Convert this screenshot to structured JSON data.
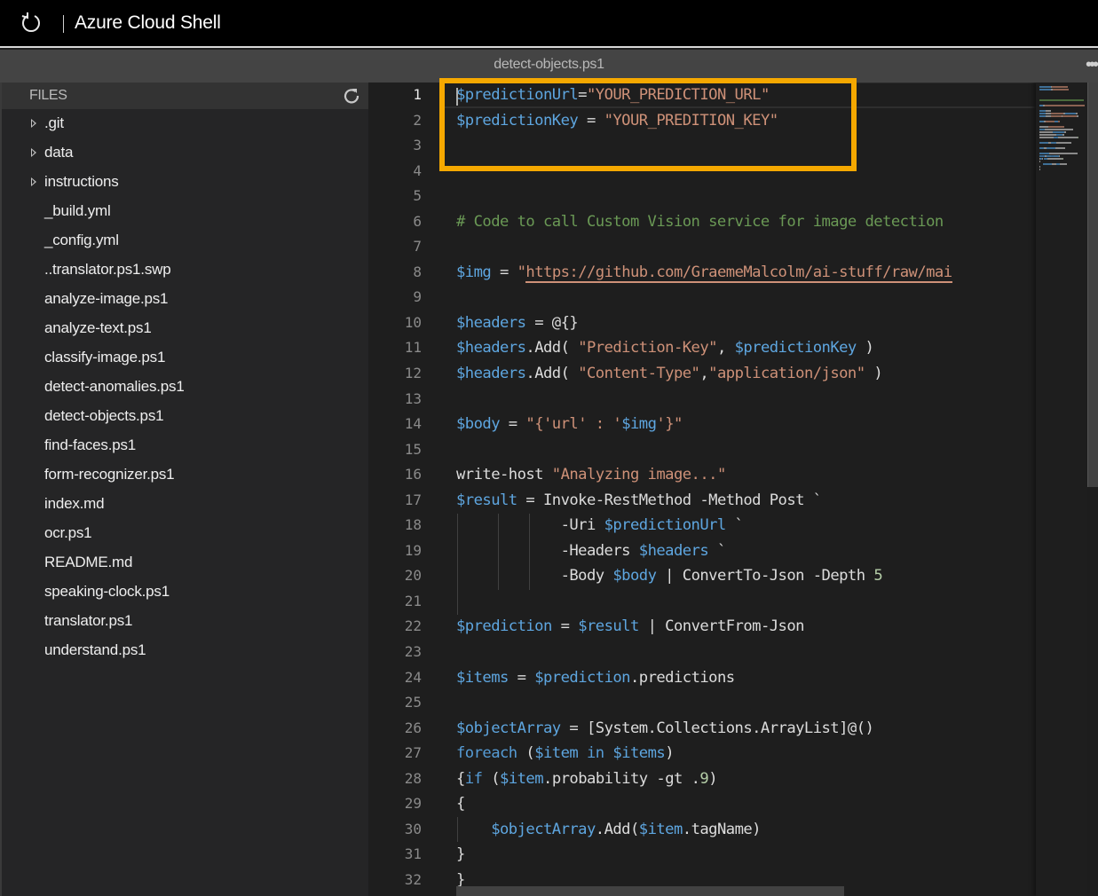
{
  "titlebar": {
    "title": "Azure Cloud Shell",
    "restart_icon": "restart-icon"
  },
  "tab": {
    "filename": "detect-objects.ps1",
    "more_icon": "ellipsis-icon"
  },
  "sidebar": {
    "header": "FILES",
    "refresh_icon": "refresh-icon",
    "items": [
      {
        "name": ".git",
        "type": "folder"
      },
      {
        "name": "data",
        "type": "folder"
      },
      {
        "name": "instructions",
        "type": "folder"
      },
      {
        "name": "_build.yml",
        "type": "file"
      },
      {
        "name": "_config.yml",
        "type": "file"
      },
      {
        "name": "..translator.ps1.swp",
        "type": "file"
      },
      {
        "name": "analyze-image.ps1",
        "type": "file"
      },
      {
        "name": "analyze-text.ps1",
        "type": "file"
      },
      {
        "name": "classify-image.ps1",
        "type": "file"
      },
      {
        "name": "detect-anomalies.ps1",
        "type": "file"
      },
      {
        "name": "detect-objects.ps1",
        "type": "file"
      },
      {
        "name": "find-faces.ps1",
        "type": "file"
      },
      {
        "name": "form-recognizer.ps1",
        "type": "file"
      },
      {
        "name": "index.md",
        "type": "file"
      },
      {
        "name": "ocr.ps1",
        "type": "file"
      },
      {
        "name": "README.md",
        "type": "file"
      },
      {
        "name": "speaking-clock.ps1",
        "type": "file"
      },
      {
        "name": "translator.ps1",
        "type": "file"
      },
      {
        "name": "understand.ps1",
        "type": "file"
      }
    ]
  },
  "editor": {
    "active_line": 1,
    "highlight_color": "#f5a800",
    "lines": [
      [
        [
          "v",
          "$predictionUrl"
        ],
        [
          "t",
          "="
        ],
        [
          "s",
          "\"YOUR_PREDICTION_URL\""
        ]
      ],
      [
        [
          "v",
          "$predictionKey"
        ],
        [
          "t",
          " = "
        ],
        [
          "s",
          "\"YOUR_PREDITION_KEY\""
        ]
      ],
      [],
      [],
      [],
      [
        [
          "c",
          "# Code to call Custom Vision service for image detection"
        ]
      ],
      [],
      [
        [
          "v",
          "$img"
        ],
        [
          "t",
          " = "
        ],
        [
          "s",
          "\""
        ],
        [
          "url",
          "https://github.com/GraemeMalcolm/ai-stuff/raw/mai"
        ]
      ],
      [],
      [
        [
          "v",
          "$headers"
        ],
        [
          "t",
          " = @{}"
        ]
      ],
      [
        [
          "v",
          "$headers"
        ],
        [
          "t",
          ".Add( "
        ],
        [
          "s",
          "\"Prediction-Key\""
        ],
        [
          "t",
          ", "
        ],
        [
          "v",
          "$predictionKey"
        ],
        [
          "t",
          " )"
        ]
      ],
      [
        [
          "v",
          "$headers"
        ],
        [
          "t",
          ".Add( "
        ],
        [
          "s",
          "\"Content-Type\""
        ],
        [
          "t",
          ","
        ],
        [
          "s",
          "\"application/json\""
        ],
        [
          "t",
          " )"
        ]
      ],
      [],
      [
        [
          "v",
          "$body"
        ],
        [
          "t",
          " = "
        ],
        [
          "s",
          "\"{'url' : '"
        ],
        [
          "v",
          "$img"
        ],
        [
          "s",
          "'}\""
        ]
      ],
      [],
      [
        [
          "t",
          "write-host "
        ],
        [
          "s",
          "\"Analyzing image...\""
        ]
      ],
      [
        [
          "v",
          "$result"
        ],
        [
          "t",
          " = Invoke-RestMethod -Method Post `"
        ]
      ],
      [
        [
          "t",
          "            -Uri "
        ],
        [
          "v",
          "$predictionUrl"
        ],
        [
          "t",
          " `"
        ]
      ],
      [
        [
          "t",
          "            -Headers "
        ],
        [
          "v",
          "$headers"
        ],
        [
          "t",
          " `"
        ]
      ],
      [
        [
          "t",
          "            -Body "
        ],
        [
          "v",
          "$body"
        ],
        [
          "t",
          " | ConvertTo-Json -Depth "
        ],
        [
          "n",
          "5"
        ]
      ],
      [],
      [
        [
          "v",
          "$prediction"
        ],
        [
          "t",
          " = "
        ],
        [
          "v",
          "$result"
        ],
        [
          "t",
          " | ConvertFrom-Json"
        ]
      ],
      [],
      [
        [
          "v",
          "$items"
        ],
        [
          "t",
          " = "
        ],
        [
          "v",
          "$prediction"
        ],
        [
          "t",
          ".predictions"
        ]
      ],
      [],
      [
        [
          "v",
          "$objectArray"
        ],
        [
          "t",
          " = [System.Collections.ArrayList]@()"
        ]
      ],
      [
        [
          "k",
          "foreach"
        ],
        [
          "t",
          " ("
        ],
        [
          "v",
          "$item"
        ],
        [
          "k",
          " in "
        ],
        [
          "v",
          "$items"
        ],
        [
          "t",
          ")"
        ]
      ],
      [
        [
          "t",
          "{"
        ],
        [
          "k",
          "if"
        ],
        [
          "t",
          " ("
        ],
        [
          "v",
          "$item"
        ],
        [
          "t",
          ".probability -gt ."
        ],
        [
          "n",
          "9"
        ],
        [
          "t",
          ")"
        ]
      ],
      [
        [
          "t",
          "{"
        ]
      ],
      [
        [
          "t",
          "    "
        ],
        [
          "v",
          "$objectArray"
        ],
        [
          "t",
          ".Add("
        ],
        [
          "v",
          "$item"
        ],
        [
          "t",
          ".tagName)"
        ]
      ],
      [
        [
          "t",
          "}"
        ]
      ],
      [
        [
          "t",
          "}"
        ]
      ]
    ]
  }
}
